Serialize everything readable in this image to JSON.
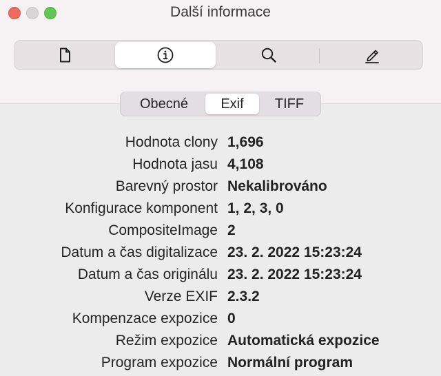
{
  "window": {
    "title": "Další informace"
  },
  "toolbar": {
    "buttons": [
      {
        "icon": "document-icon"
      },
      {
        "icon": "info-icon",
        "active": true
      },
      {
        "icon": "magnifier-icon"
      },
      {
        "icon": "pencil-icon"
      }
    ]
  },
  "tabs": [
    {
      "label": "Obecné"
    },
    {
      "label": "Exif",
      "active": true
    },
    {
      "label": "TIFF"
    }
  ],
  "exif": [
    {
      "label": "Hodnota clony",
      "value": "1,696"
    },
    {
      "label": "Hodnota jasu",
      "value": "4,108"
    },
    {
      "label": "Barevný prostor",
      "value": "Nekalibrováno"
    },
    {
      "label": "Konfigurace komponent",
      "value": "1, 2, 3, 0"
    },
    {
      "label": "CompositeImage",
      "value": "2"
    },
    {
      "label": "Datum a čas digitalizace",
      "value": "23. 2. 2022 15:23:24"
    },
    {
      "label": "Datum a čas originálu",
      "value": "23. 2. 2022 15:23:24"
    },
    {
      "label": "Verze EXIF",
      "value": "2.3.2"
    },
    {
      "label": "Kompenzace expozice",
      "value": "0"
    },
    {
      "label": "Režim expozice",
      "value": "Automatická expozice"
    },
    {
      "label": "Program expozice",
      "value": "Normální program"
    }
  ]
}
